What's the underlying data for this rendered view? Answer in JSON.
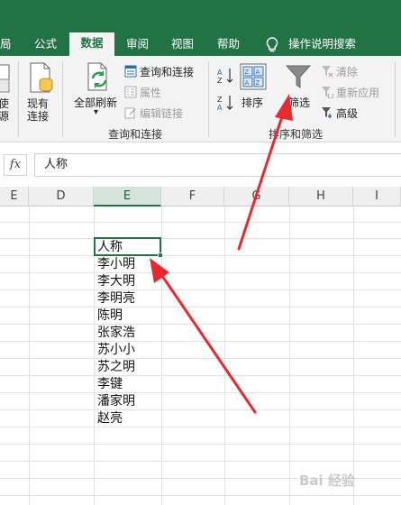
{
  "tabs": [
    {
      "label": "局",
      "active": false
    },
    {
      "label": "公式",
      "active": false
    },
    {
      "label": "数据",
      "active": true
    },
    {
      "label": "审阅",
      "active": false
    },
    {
      "label": "视图",
      "active": false
    },
    {
      "label": "帮助",
      "active": false
    },
    {
      "label": "操作说明搜索",
      "active": false
    }
  ],
  "ribbon": {
    "get_data": {
      "line1": "使",
      "line2": "源"
    },
    "existing": {
      "line1": "现有",
      "line2": "连接"
    },
    "refresh_all": {
      "label": "全部刷新",
      "arrow": "▾"
    },
    "queries_connections": {
      "items": [
        {
          "label": "查询和连接",
          "enabled": true
        },
        {
          "label": "属性",
          "enabled": false
        },
        {
          "label": "编辑链接",
          "enabled": false
        }
      ],
      "group_label": "查询和连接"
    },
    "sort_filter": {
      "sort_label": "排序",
      "filter_label": "筛选",
      "clear_label": "清除",
      "reapply_label": "重新应用",
      "advanced_label": "高级",
      "group_label": "排序和筛选",
      "sort_icon_text": "ZA AZ"
    }
  },
  "formula_bar": {
    "fx": "fx",
    "value": "人称"
  },
  "columns": [
    "E",
    "D",
    "E",
    "F",
    "G",
    "H",
    "I"
  ],
  "selected_column": "E",
  "cells": [
    "人称",
    "李小明",
    "李大明",
    "李明亮",
    "陈明",
    "张家浩",
    "苏小小",
    "苏之明",
    "李键",
    "潘家明",
    "赵亮"
  ],
  "watermark": "Bai 经验",
  "colors": {
    "accent": "#217346",
    "arrow": "#e8292f"
  }
}
